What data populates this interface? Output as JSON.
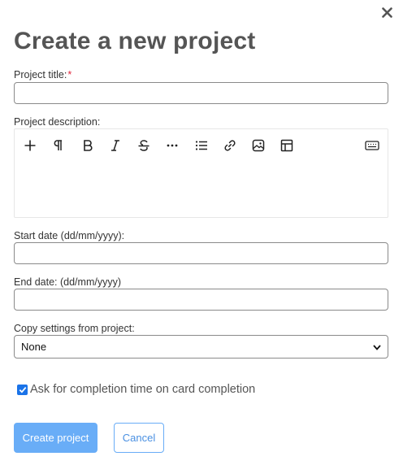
{
  "dialog": {
    "title": "Create a new project",
    "close_icon": "close-icon"
  },
  "form": {
    "title_label": "Project title:",
    "required_mark": "*",
    "title_value": "",
    "description_label": "Project description:",
    "start_date_label": "Start date (dd/mm/yyyy):",
    "start_date_value": "",
    "end_date_label": "End date: (dd/mm/yyyy)",
    "end_date_value": "",
    "copy_settings_label": "Copy settings from project:",
    "copy_settings_value": "None",
    "completion_checkbox_checked": true,
    "completion_checkbox_label": "Ask for completion time on card completion"
  },
  "editor_toolbar": [
    {
      "icon": "plus-icon"
    },
    {
      "icon": "paragraph-icon"
    },
    {
      "icon": "bold-icon"
    },
    {
      "icon": "italic-icon"
    },
    {
      "icon": "strikethrough-icon"
    },
    {
      "icon": "more-icon"
    },
    {
      "icon": "bulleted-list-icon"
    },
    {
      "icon": "link-icon"
    },
    {
      "icon": "image-icon"
    },
    {
      "icon": "table-icon"
    },
    {
      "icon": "keyboard-icon"
    }
  ],
  "buttons": {
    "create_label": "Create project",
    "cancel_label": "Cancel"
  },
  "colors": {
    "primary": "#69adf7",
    "title": "#555555",
    "required": "#e0253b",
    "checkbox": "#1a73e8"
  }
}
